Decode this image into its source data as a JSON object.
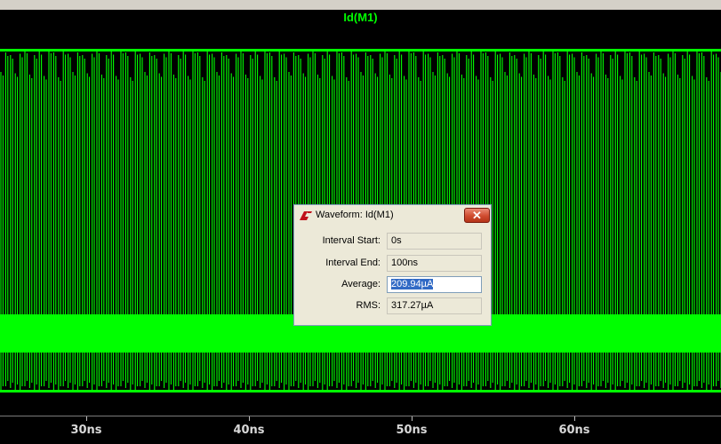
{
  "trace": {
    "title": "Id(M1)",
    "color": "#00ff00"
  },
  "xaxis": {
    "ticks": [
      {
        "label": "30ns"
      },
      {
        "label": "40ns"
      },
      {
        "label": "50ns"
      },
      {
        "label": "60ns"
      }
    ]
  },
  "dialog": {
    "title": "Waveform: Id(M1)",
    "app_icon": "ltspice-logo-icon",
    "close_icon": "close-icon",
    "close_glyph": "✕",
    "fields": [
      {
        "label": "Interval Start:",
        "value": "0s"
      },
      {
        "label": "Interval End:",
        "value": "100ns"
      },
      {
        "label": "Average:",
        "value": "209.94µA",
        "selected": true
      },
      {
        "label": "RMS:",
        "value": "317.27µA"
      }
    ]
  }
}
